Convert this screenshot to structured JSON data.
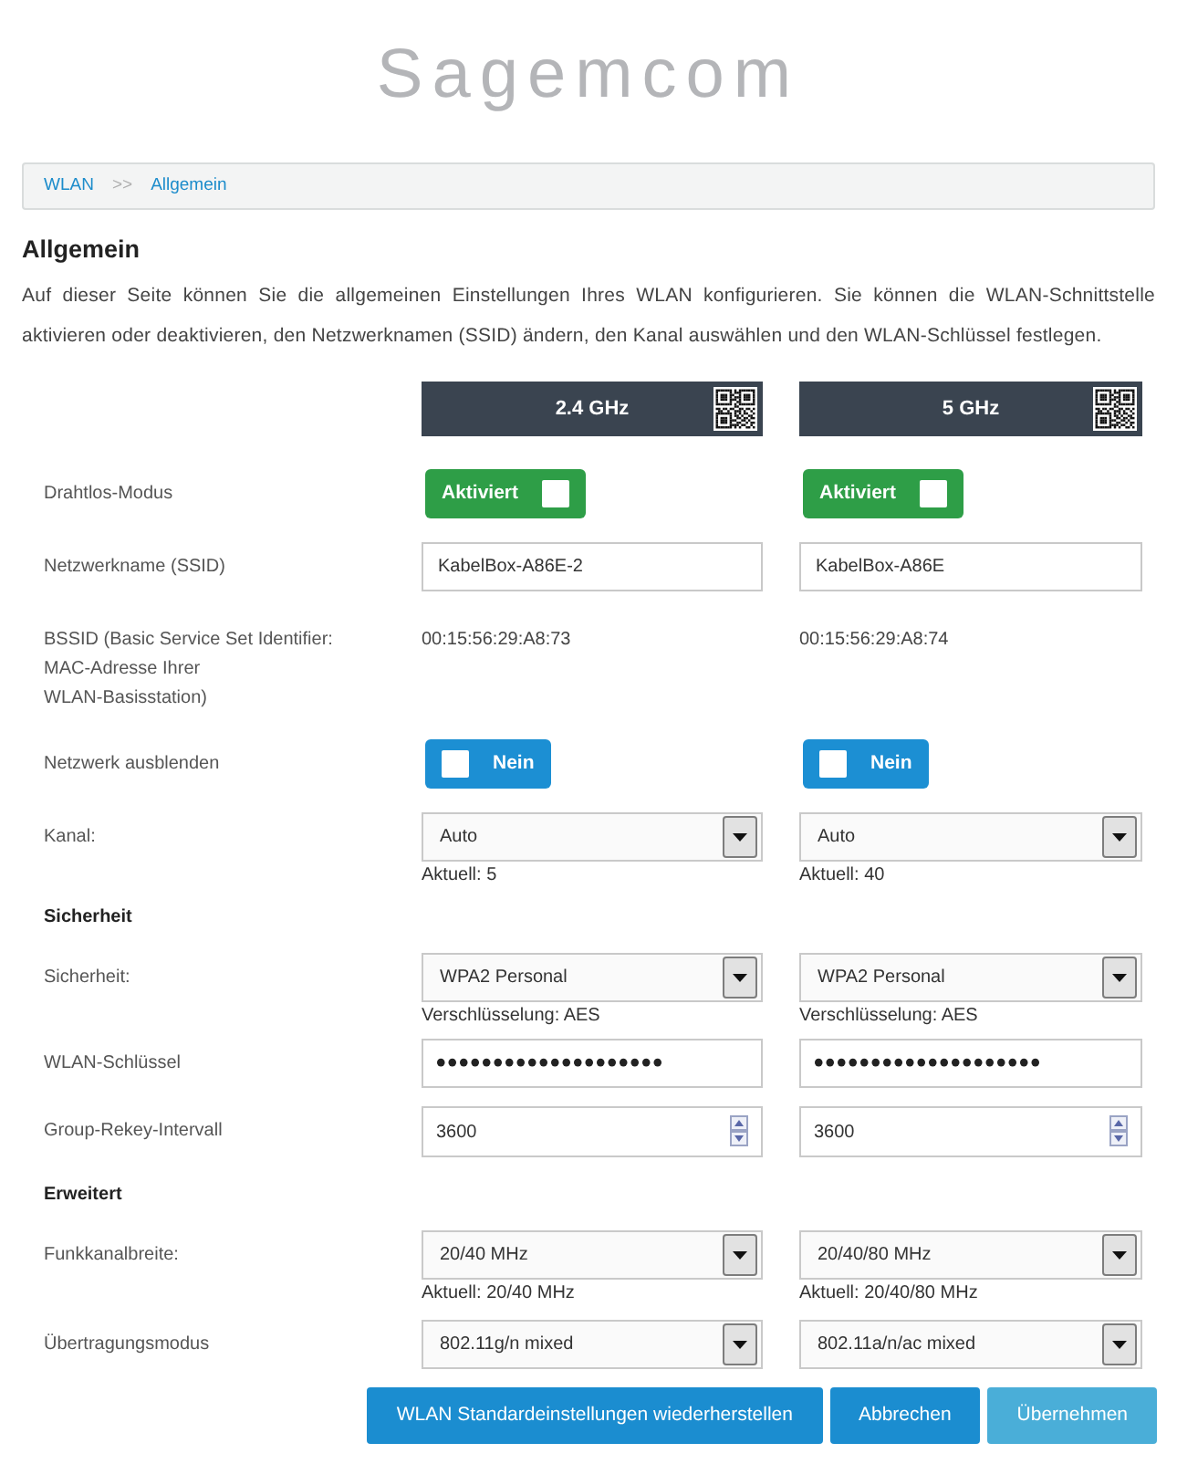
{
  "logo": {
    "text": "Sagemcom"
  },
  "breadcrumb": {
    "items": [
      {
        "label": "WLAN"
      },
      {
        "label": "Allgemein"
      }
    ],
    "separator": ">>"
  },
  "heading": "Allgemein",
  "description": "Auf dieser Seite können Sie die allgemeinen Einstellungen Ihres WLAN konfigurieren. Sie können die WLAN-Schnittstelle aktivieren oder deaktivieren, den Netzwerknamen (SSID) ändern, den Kanal auswählen und den WLAN-Schlüssel festlegen.",
  "bands": [
    {
      "label": "2.4 GHz"
    },
    {
      "label": "5 GHz"
    }
  ],
  "rows": [
    {
      "kind": "toggle",
      "label": "Drahtlos-Modus",
      "values": [
        {
          "text": "Aktiviert",
          "on": true
        },
        {
          "text": "Aktiviert",
          "on": true
        }
      ]
    },
    {
      "kind": "text_input",
      "label": "Netzwerkname (SSID)",
      "values": [
        {
          "value": "KabelBox-A86E-2"
        },
        {
          "value": "KabelBox-A86E"
        }
      ]
    },
    {
      "kind": "static",
      "label": "BSSID (Basic Service Set Identifier: MAC-Adresse Ihrer WLAN-Basisstation)",
      "values": [
        {
          "text": "00:15:56:29:A8:73"
        },
        {
          "text": "00:15:56:29:A8:74"
        }
      ]
    },
    {
      "kind": "toggle",
      "label": "Netzwerk ausblenden",
      "values": [
        {
          "text": "Nein",
          "on": false
        },
        {
          "text": "Nein",
          "on": false
        }
      ]
    },
    {
      "kind": "select",
      "label": "Kanal:",
      "values": [
        {
          "value": "Auto",
          "note": "Aktuell: 5"
        },
        {
          "value": "Auto",
          "note": "Aktuell: 40"
        }
      ]
    },
    {
      "kind": "section",
      "label": "Sicherheit"
    },
    {
      "kind": "select",
      "label": "Sicherheit:",
      "values": [
        {
          "value": "WPA2 Personal",
          "note": "Verschlüsselung: AES"
        },
        {
          "value": "WPA2 Personal",
          "note": "Verschlüsselung: AES"
        }
      ]
    },
    {
      "kind": "password",
      "label": "WLAN-Schlüssel",
      "values": [
        {
          "value": "••••••••••••••••••••"
        },
        {
          "value": "••••••••••••••••••••"
        }
      ]
    },
    {
      "kind": "number",
      "label": "Group-Rekey-Intervall",
      "values": [
        {
          "value": "3600"
        },
        {
          "value": "3600"
        }
      ]
    },
    {
      "kind": "section",
      "label": "Erweitert"
    },
    {
      "kind": "select",
      "label": "Funkkanalbreite:",
      "values": [
        {
          "value": "20/40 MHz",
          "note": "Aktuell: 20/40 MHz"
        },
        {
          "value": "20/40/80 MHz",
          "note": "Aktuell: 20/40/80 MHz"
        }
      ]
    },
    {
      "kind": "select",
      "label": "Übertragungsmodus",
      "values": [
        {
          "value": "802.11g/n mixed"
        },
        {
          "value": "802.11a/n/ac mixed"
        }
      ]
    }
  ],
  "buttons": [
    {
      "label": "WLAN Standardeinstellungen wiederherstellen",
      "disabled": false
    },
    {
      "label": "Abbrechen",
      "disabled": false
    },
    {
      "label": "Übernehmen",
      "disabled": true
    }
  ]
}
